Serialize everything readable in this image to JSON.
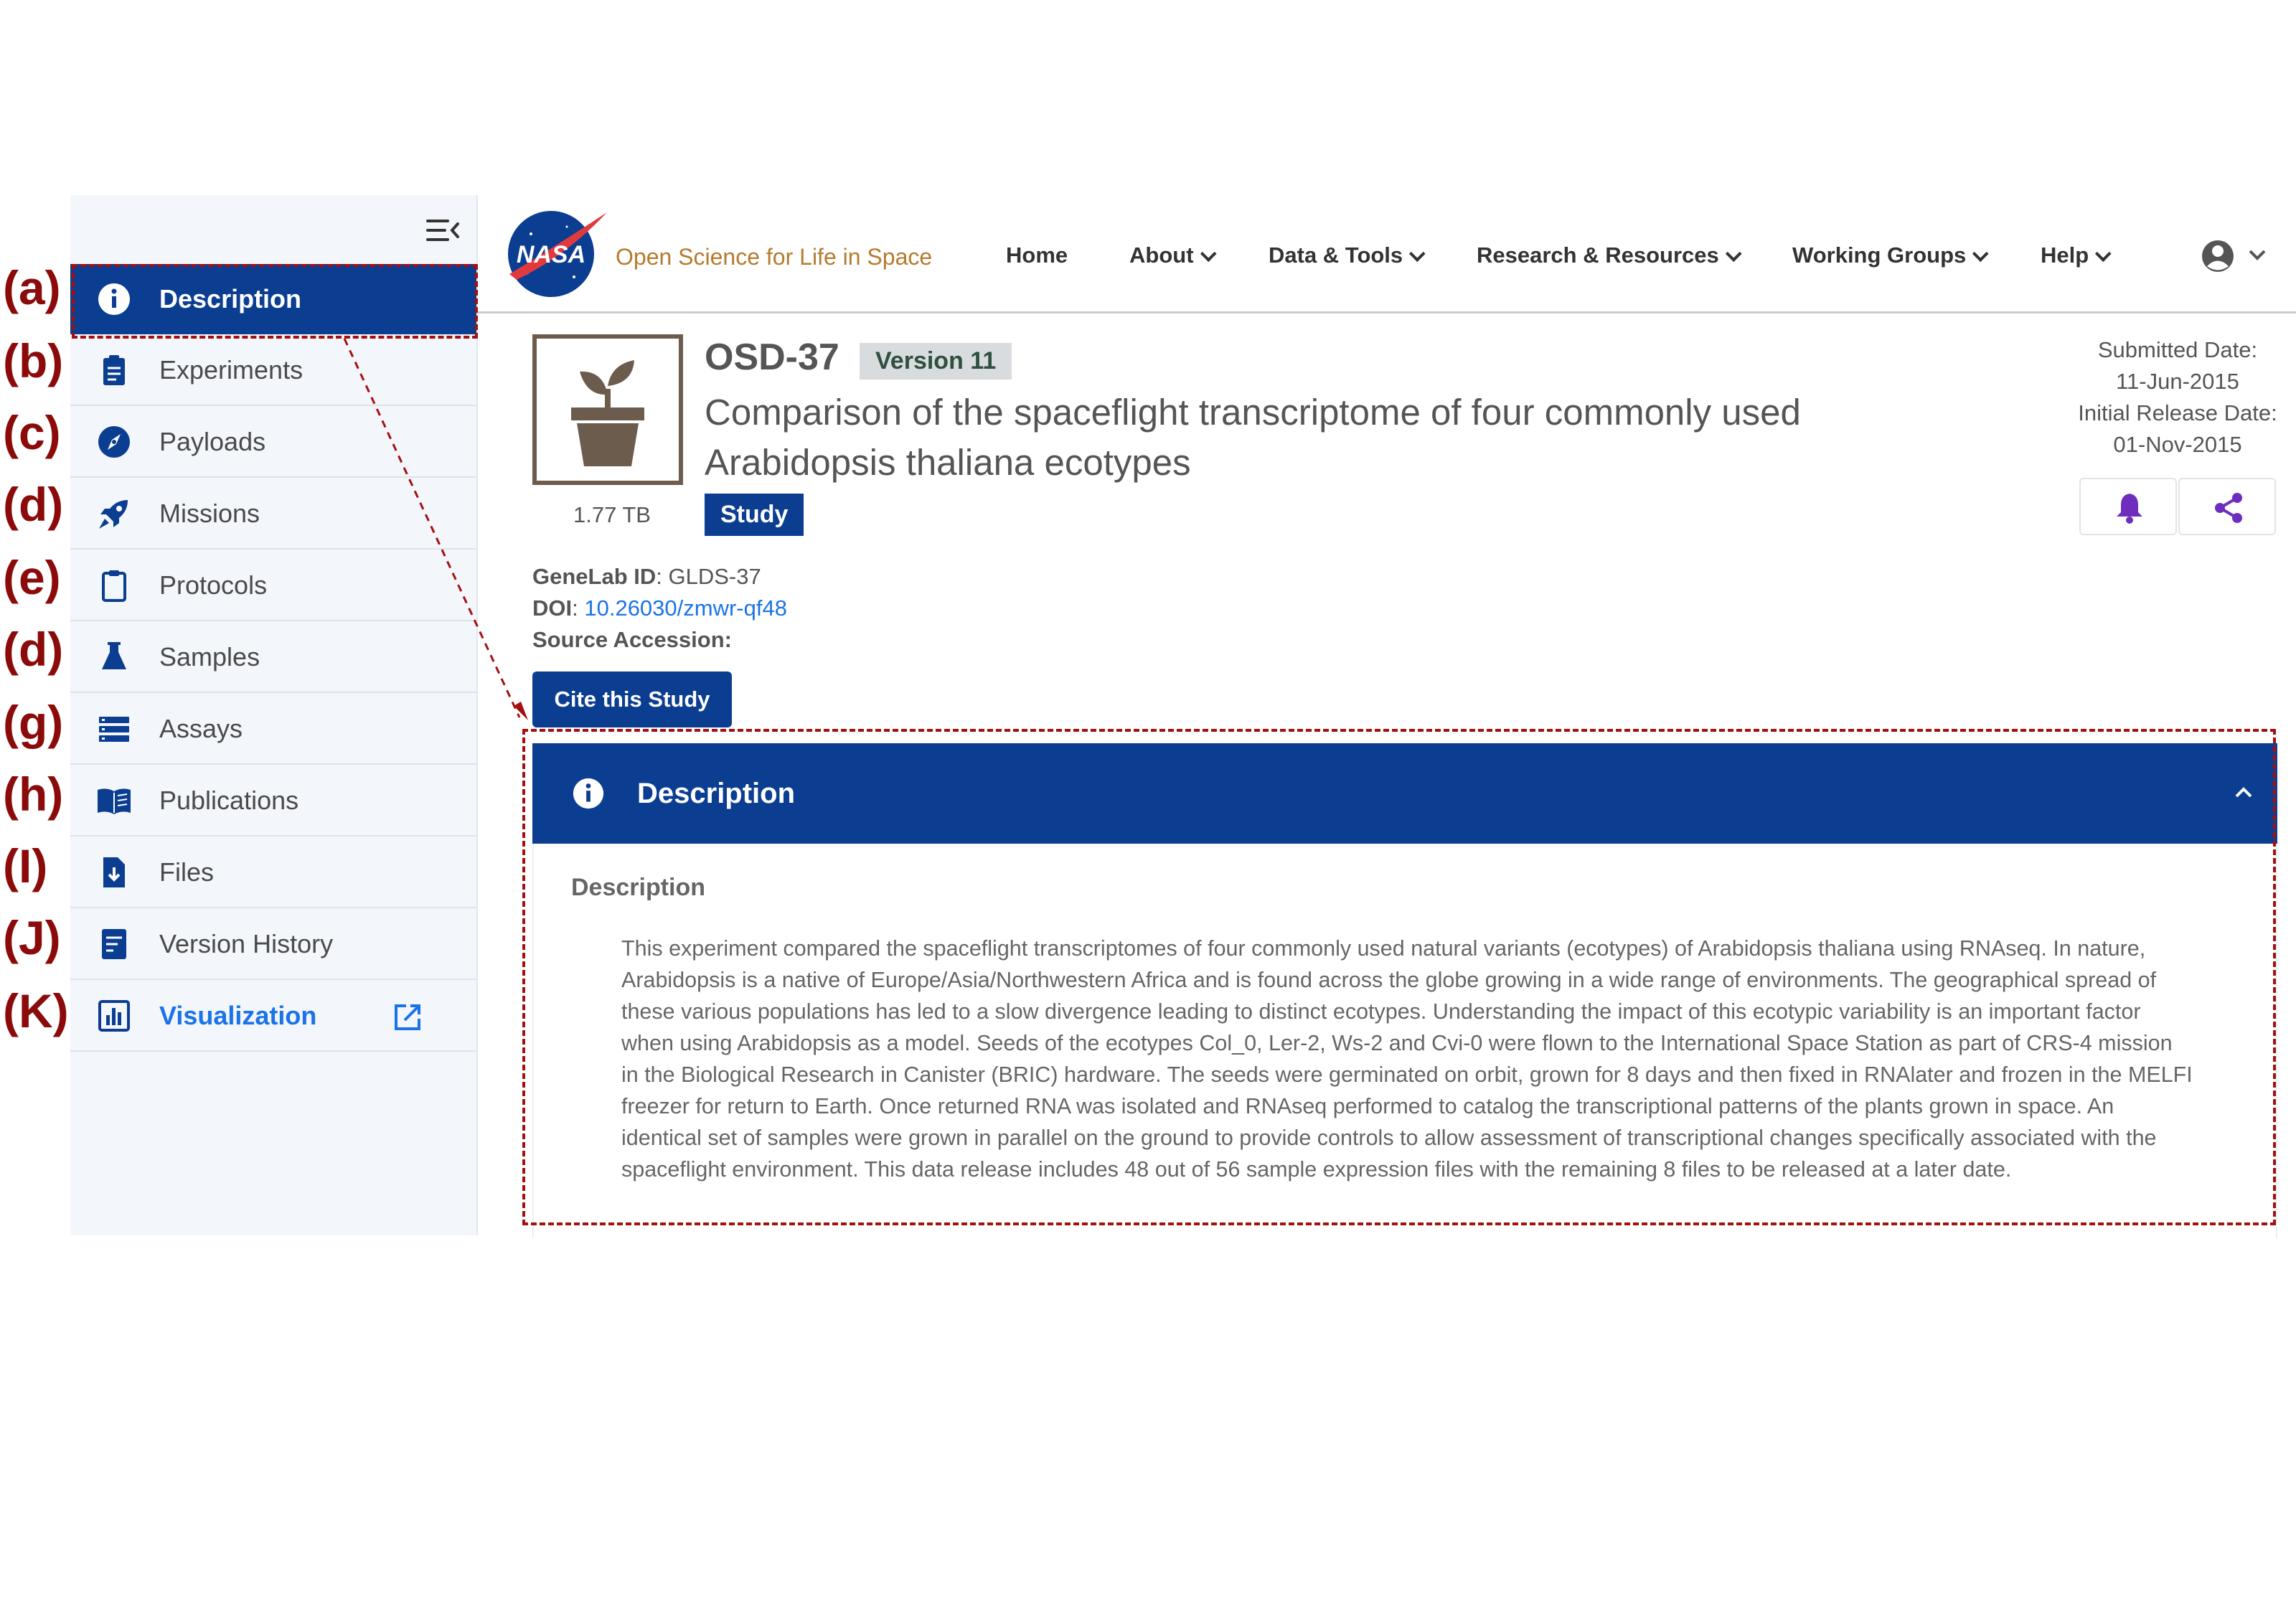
{
  "header": {
    "tagline": "Open Science for Life in Space",
    "menu": [
      "Home",
      "About",
      "Data & Tools",
      "Research & Resources",
      "Working Groups",
      "Help"
    ]
  },
  "sidebar": {
    "items": [
      {
        "label": "Description",
        "icon": "info-icon"
      },
      {
        "label": "Experiments",
        "icon": "clipboard-list-icon"
      },
      {
        "label": "Payloads",
        "icon": "compass-icon"
      },
      {
        "label": "Missions",
        "icon": "rocket-icon"
      },
      {
        "label": "Protocols",
        "icon": "clipboard-icon"
      },
      {
        "label": "Samples",
        "icon": "flask-icon"
      },
      {
        "label": "Assays",
        "icon": "list-icon"
      },
      {
        "label": "Publications",
        "icon": "book-icon"
      },
      {
        "label": "Files",
        "icon": "file-download-icon"
      },
      {
        "label": "Version History",
        "icon": "history-file-icon"
      },
      {
        "label": "Visualization",
        "icon": "bar-chart-icon"
      }
    ]
  },
  "annotations": [
    "(a)",
    "(b)",
    "(c)",
    "(d)",
    "(e)",
    "(d)",
    "(g)",
    "(h)",
    "(I)",
    "(J)",
    "(K)"
  ],
  "study": {
    "id": "OSD-37",
    "version": "Version 11",
    "title": "Comparison of the spaceflight transcriptome of four commonly used Arabidopsis thaliana ecotypes",
    "size": "1.77 TB",
    "type": "Study",
    "submitted_label": "Submitted Date:",
    "submitted": "11-Jun-2015",
    "release_label": "Initial Release Date:",
    "release": "01-Nov-2015",
    "genelab_label": "GeneLab ID",
    "genelab_id": "GLDS-37",
    "doi_label": "DOI",
    "doi": "10.26030/zmwr-qf48",
    "source_label": "Source Accession:",
    "cite_label": "Cite this Study"
  },
  "panel": {
    "title": "Description",
    "subtitle": "Description",
    "text": "This experiment compared the spaceflight transcriptomes of four commonly used natural variants (ecotypes) of Arabidopsis thaliana using RNAseq. In nature, Arabidopsis is a native of Europe/Asia/Northwestern Africa and is found across the globe growing in a wide range of environments. The geographical spread of these various populations has led to a slow divergence leading to distinct ecotypes. Understanding the impact of this ecotypic variability is an important factor when using Arabidopsis as a model. Seeds of the ecotypes Col_0, Ler-2, Ws-2 and Cvi-0 were flown to the International Space Station as part of CRS-4 mission in the Biological Research in Canister (BRIC) hardware. The seeds were germinated on orbit, grown for 8 days and then fixed in RNAlater and frozen in the MELFI freezer for return to Earth. Once returned RNA was isolated and RNAseq performed to catalog the transcriptional patterns of the plants grown in space. An identical set of samples were grown in parallel on the ground to provide controls to allow assessment of transcriptional changes specifically associated with the spaceflight environment. This data release includes 48 out of 56 sample expression files with the remaining 8 files to be released at a later date."
  },
  "colors": {
    "nasa_blue": "#0b3d91",
    "link": "#1a73e8",
    "annotation": "#a40f0f",
    "tagline": "#b57b2e"
  }
}
